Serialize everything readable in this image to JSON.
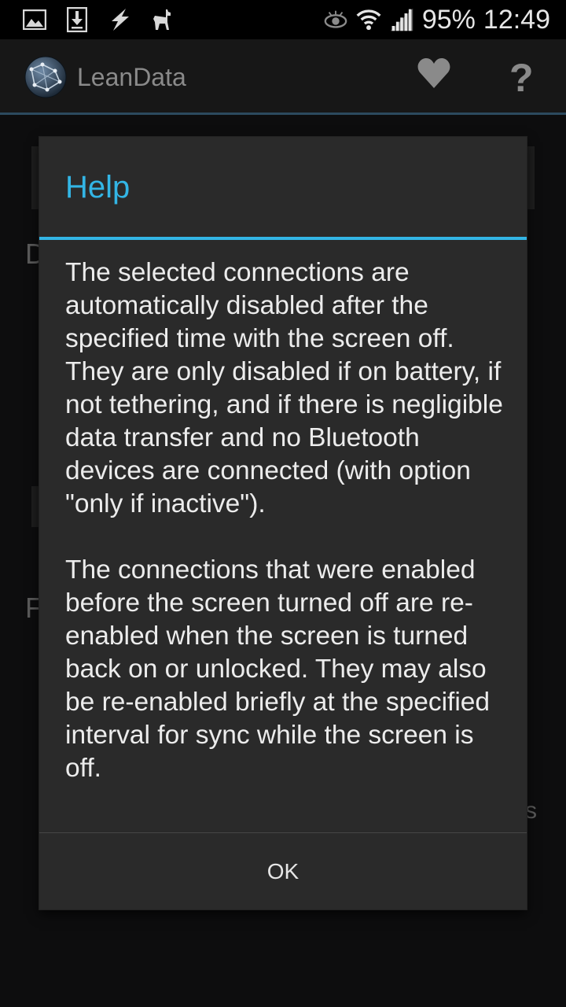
{
  "status_bar": {
    "icons_left": [
      "gallery-icon",
      "download-icon",
      "flash-icon",
      "llama-icon"
    ],
    "icons_right": [
      "eye-icon",
      "wifi-icon",
      "signal-icon"
    ],
    "battery": "95%",
    "time": "12:49"
  },
  "action_bar": {
    "app_title": "LeanData",
    "icons": [
      "globe-logo-icon",
      "heart-icon",
      "help-icon"
    ],
    "help_glyph": "?"
  },
  "dialog": {
    "title": "Help",
    "paragraphs": [
      "The selected connections are automatically disabled after the specified time with the screen off. They are only disabled if on battery, if not tethering, and if there is negligible data transfer and no Bluetooth devices are connected (with option \"only if inactive\").",
      "The connections that were enabled before the screen turned off are re-enabled when the screen is turned back on or unlocked. They may also be re-enabled briefly at the specified interval for sync while the screen is off."
    ],
    "ok_label": "OK"
  },
  "background": {
    "letters": [
      "D",
      "F",
      "s"
    ]
  },
  "colors": {
    "accent": "#33b5e5",
    "dialog_bg": "#2a2a2a",
    "actionbar_bg": "#171717"
  }
}
